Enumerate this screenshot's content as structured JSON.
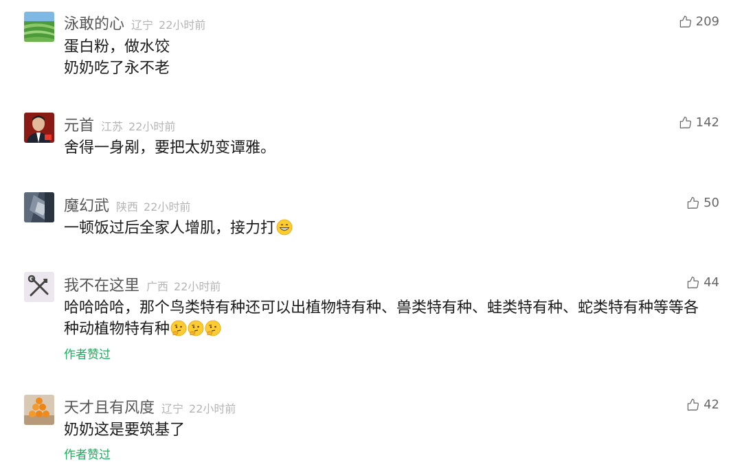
{
  "comments": [
    {
      "nickname": "泳敢的心",
      "location": "辽宁",
      "time": "22小时前",
      "likes": "209",
      "lines": [
        "蛋白粉，做水饺",
        "奶奶吃了永不老"
      ],
      "avatar_icon": "green-field-avatar"
    },
    {
      "nickname": "元首",
      "location": "江苏",
      "time": "22小时前",
      "likes": "142",
      "lines": [
        "舍得一身剐，要把太奶变谭雅。"
      ],
      "avatar_icon": "portrait-avatar"
    },
    {
      "nickname": "魔幻武",
      "location": "陕西",
      "time": "22小时前",
      "likes": "50",
      "lines": [
        "一顿饭过后全家人增肌，接力打"
      ],
      "emoji": "grin-emoji",
      "avatar_icon": "dark-scene-avatar"
    },
    {
      "nickname": "我不在这里",
      "location": "广西",
      "time": "22小时前",
      "likes": "44",
      "lines": [
        "哈哈哈哈，那个鸟类特有种还可以出植物特有种、兽类特有种、蛙类特有种、蛇类特有种等等各",
        "种动植物特有种"
      ],
      "emoji": "thinking-emoji",
      "author_liked": "作者赞过",
      "avatar_icon": "tools-avatar"
    },
    {
      "nickname": "天才且有风度",
      "location": "辽宁",
      "time": "22小时前",
      "likes": "42",
      "lines": [
        "奶奶这是要筑基了"
      ],
      "author_liked": "作者赞过",
      "avatar_icon": "orange-tower-avatar"
    }
  ],
  "colors": {
    "nickname": "#555555",
    "meta": "#b4b4b4",
    "author_liked": "#1aad5c"
  }
}
